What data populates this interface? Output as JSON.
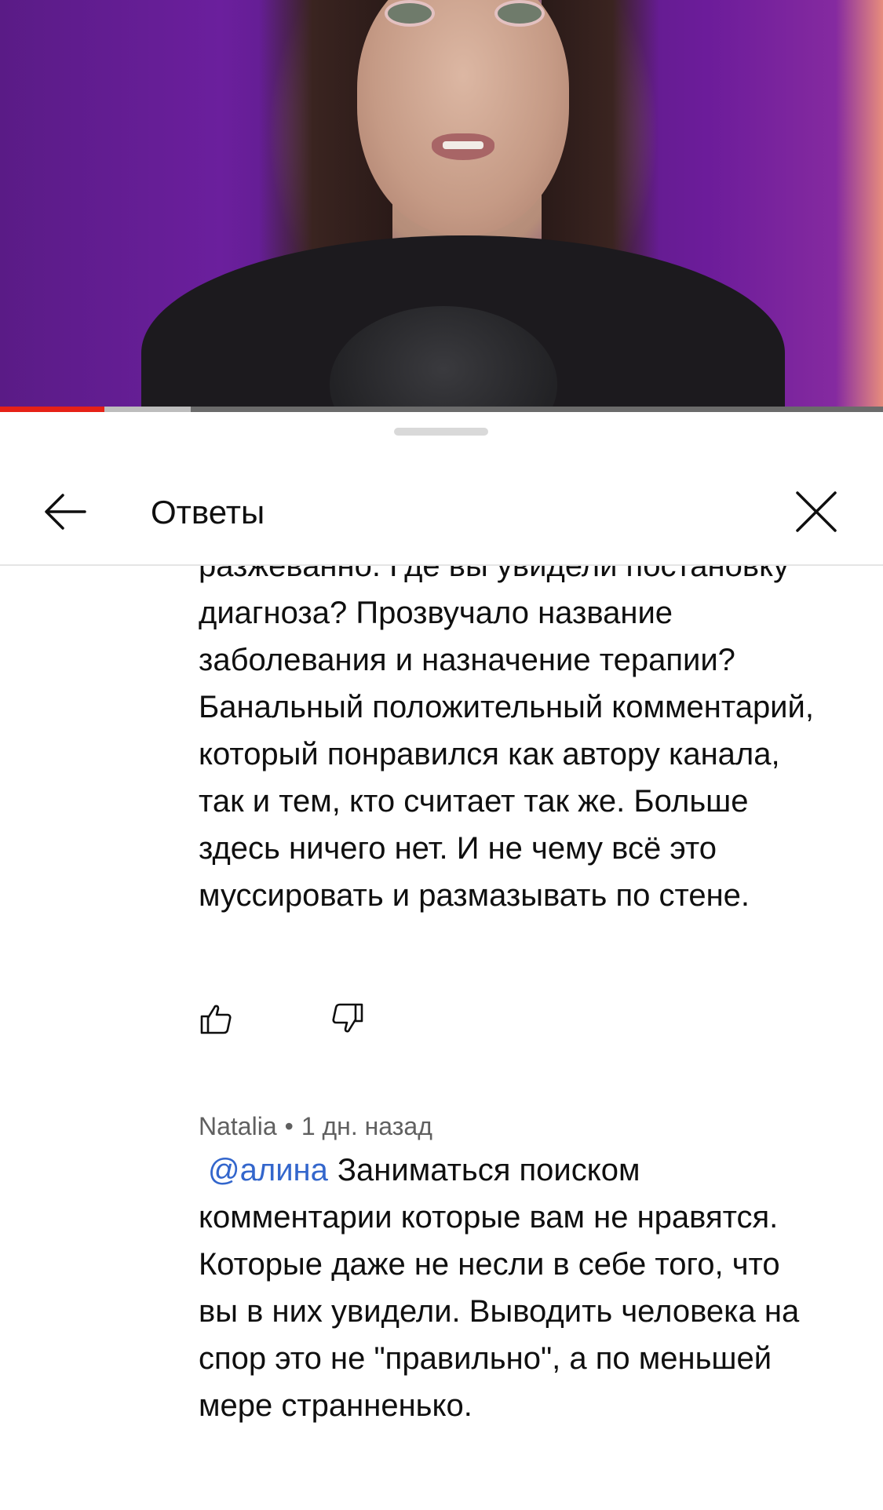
{
  "video": {
    "progress_percent": 11.8,
    "buffered_percent": 21.6,
    "colors": {
      "progress": "#e62117",
      "buffer": "#bdbdbd",
      "track": "#6b6b6b"
    }
  },
  "header": {
    "title": "Ответы",
    "back_icon": "arrow-left-icon",
    "close_icon": "close-icon"
  },
  "comments": [
    {
      "text": "разжеванно. Где вы увидели постановку диагноза? Прозвучало название заболевания и назначение терапии? Банальный положительный комментарий, который понравился как автору канала, так и тем, кто считает так же. Больше здесь ничего нет. И не чему всё это муссировать и размазывать по стене.",
      "actions": {
        "like_icon": "thumbs-up-icon",
        "dislike_icon": "thumbs-down-icon"
      }
    },
    {
      "author": "Natalia",
      "separator": "•",
      "time": "1 дн. назад",
      "mention": "@алина",
      "text": "Заниматься поиском комментарии которые вам не нравятся. Которые даже не несли в себе того, что вы в них увидели. Выводить человека на спор это не \"правильно\", а по меньшей мере странненько."
    }
  ]
}
